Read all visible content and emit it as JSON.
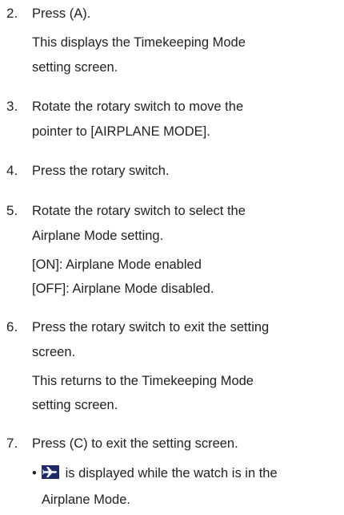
{
  "steps": [
    {
      "num": "2.",
      "text": "Press (A).",
      "note": [
        "This displays the Timekeeping Mode",
        "setting screen."
      ]
    },
    {
      "num": "3.",
      "text": [
        "Rotate the rotary switch to move the",
        "pointer to [AIRPLANE MODE]."
      ]
    },
    {
      "num": "4.",
      "text": "Press the rotary switch."
    },
    {
      "num": "5.",
      "text": [
        "Rotate the rotary switch to select the",
        "Airplane Mode setting."
      ],
      "note": [
        "[ON]: Airplane Mode enabled",
        "[OFF]: Airplane Mode disabled."
      ]
    },
    {
      "num": "6.",
      "text": [
        "Press the rotary switch to exit the setting",
        "screen."
      ],
      "note": [
        "This returns to the Timekeeping Mode",
        "setting screen."
      ]
    },
    {
      "num": "7.",
      "text": "Press (C) to exit the setting screen."
    }
  ],
  "bullet": {
    "symbol": "•",
    "icon": "airplane-icon",
    "line1": " is displayed while the watch is in the",
    "line2": "Airplane Mode."
  },
  "colors": {
    "text": "#231f20",
    "icon_bg": "#1f2a6b"
  }
}
